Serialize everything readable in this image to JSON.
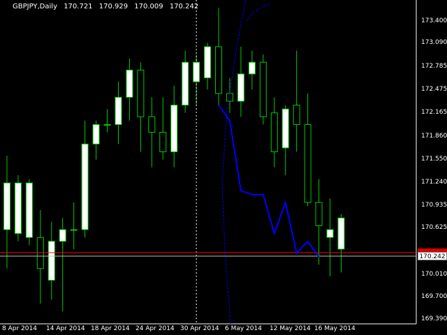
{
  "header": {
    "symbol": "GBPJPY,Daily",
    "open": "170.721",
    "high": "170.929",
    "low": "170.009",
    "close": "170.242"
  },
  "price_axis": [
    "173.400",
    "173.090",
    "172.785",
    "172.475",
    "172.165",
    "171.860",
    "171.550",
    "171.240",
    "170.935",
    "170.625",
    "170.010",
    "169.700",
    "169.390"
  ],
  "current_bid": "170.242",
  "date_axis": [
    "8 Apr 2014",
    "14 Apr 2014",
    "18 Apr 2014",
    "24 Apr 2014",
    "30 Apr 2014",
    "6 May 2014",
    "12 May 2014",
    "16 May 2014"
  ],
  "colors": {
    "background": "#000000",
    "bull_candle": "#ffffff",
    "bear_candle": "#000000",
    "candle_outline": "#00cc00",
    "forecast_line": "#0000ff",
    "bid_line": "#c0c0c0",
    "ask_line": "#ff0000",
    "separator": "#ffffff"
  },
  "chart_data": {
    "type": "candlestick",
    "symbol": "GBPJPY",
    "timeframe": "Daily",
    "ylim": [
      169.39,
      173.55
    ],
    "candles": [
      {
        "o": 170.6,
        "h": 171.55,
        "l": 170.1,
        "c": 171.2
      },
      {
        "o": 170.55,
        "h": 171.3,
        "l": 170.45,
        "c": 171.2
      },
      {
        "o": 170.5,
        "h": 171.25,
        "l": 170.4,
        "c": 171.2
      },
      {
        "o": 170.5,
        "h": 170.85,
        "l": 169.65,
        "c": 170.1
      },
      {
        "o": 169.95,
        "h": 170.7,
        "l": 169.7,
        "c": 170.45
      },
      {
        "o": 170.45,
        "h": 170.75,
        "l": 169.55,
        "c": 170.6
      },
      {
        "o": 170.6,
        "h": 170.95,
        "l": 170.35,
        "c": 170.6
      },
      {
        "o": 170.6,
        "h": 172.0,
        "l": 170.5,
        "c": 171.7
      },
      {
        "o": 171.7,
        "h": 172.0,
        "l": 171.5,
        "c": 171.95
      },
      {
        "o": 171.95,
        "h": 172.15,
        "l": 171.85,
        "c": 171.95
      },
      {
        "o": 171.95,
        "h": 172.5,
        "l": 171.7,
        "c": 172.3
      },
      {
        "o": 172.3,
        "h": 172.8,
        "l": 172.0,
        "c": 172.65
      },
      {
        "o": 172.65,
        "h": 172.75,
        "l": 171.6,
        "c": 172.05
      },
      {
        "o": 172.05,
        "h": 172.3,
        "l": 171.4,
        "c": 171.85
      },
      {
        "o": 171.85,
        "h": 172.3,
        "l": 171.5,
        "c": 171.6
      },
      {
        "o": 171.6,
        "h": 172.45,
        "l": 171.4,
        "c": 172.2
      },
      {
        "o": 172.2,
        "h": 172.9,
        "l": 172.1,
        "c": 172.75
      },
      {
        "o": 172.5,
        "h": 172.85,
        "l": 172.2,
        "c": 172.75
      },
      {
        "o": 172.55,
        "h": 173.0,
        "l": 172.4,
        "c": 172.95
      },
      {
        "o": 172.95,
        "h": 173.45,
        "l": 172.2,
        "c": 172.35
      },
      {
        "o": 172.35,
        "h": 172.55,
        "l": 172.1,
        "c": 172.25
      },
      {
        "o": 172.25,
        "h": 172.95,
        "l": 172.05,
        "c": 172.6
      },
      {
        "o": 172.6,
        "h": 172.9,
        "l": 172.4,
        "c": 172.75
      },
      {
        "o": 172.75,
        "h": 172.85,
        "l": 171.95,
        "c": 172.05
      },
      {
        "o": 172.1,
        "h": 172.3,
        "l": 171.4,
        "c": 171.6
      },
      {
        "o": 171.65,
        "h": 172.2,
        "l": 171.3,
        "c": 172.15
      },
      {
        "o": 172.2,
        "h": 172.9,
        "l": 171.6,
        "c": 171.95
      },
      {
        "o": 171.95,
        "h": 172.35,
        "l": 170.9,
        "c": 170.95
      },
      {
        "o": 170.95,
        "h": 171.25,
        "l": 170.15,
        "c": 170.65
      },
      {
        "o": 170.5,
        "h": 171.0,
        "l": 170.0,
        "c": 170.6
      },
      {
        "o": 170.35,
        "h": 170.8,
        "l": 170.05,
        "c": 170.75
      }
    ],
    "forecast_line": [
      172.2,
      172.0,
      171.1,
      171.05,
      171.05,
      170.55,
      170.95,
      170.3,
      170.45,
      170.25
    ],
    "forecast_start_index": 19,
    "vertical_separator_index": 17
  }
}
